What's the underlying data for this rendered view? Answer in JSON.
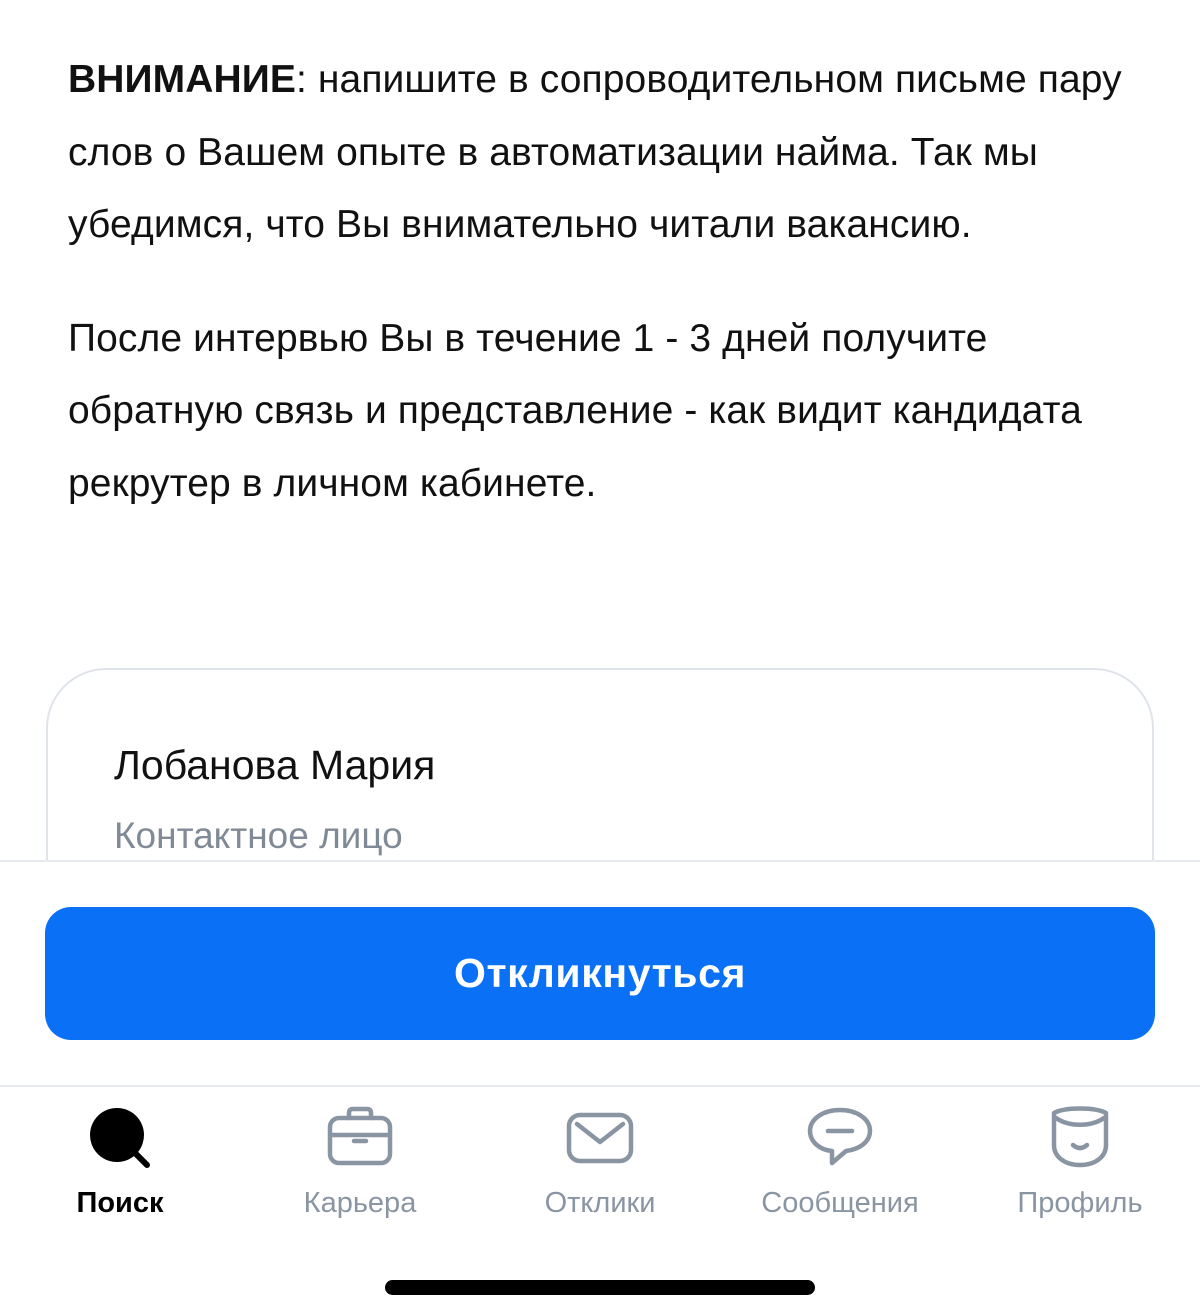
{
  "vacancy": {
    "attention_bold": "ВНИМАНИЕ",
    "attention_text": ": напишите в сопроводительном письме пару слов о Вашем опыте в автоматизации найма. Так мы убедимся, что Вы внимательно читали вакансию.",
    "feedback_text": "После интервью Вы в течение 1 - 3 дней получите обратную связь и представление - как видит кандидата рекрутер в личном кабинете."
  },
  "contact": {
    "name": "Лобанова Мария",
    "role": "Контактное лицо"
  },
  "action": {
    "respond_label": "Откликнуться",
    "color": "#0a70f5"
  },
  "tabbar": {
    "items": [
      {
        "label": "Поиск",
        "icon": "search-icon",
        "active": true
      },
      {
        "label": "Карьера",
        "icon": "briefcase-icon",
        "active": false
      },
      {
        "label": "Отклики",
        "icon": "envelope-icon",
        "active": false
      },
      {
        "label": "Сообщения",
        "icon": "chat-bubble-icon",
        "active": false
      },
      {
        "label": "Профиль",
        "icon": "profile-face-icon",
        "active": false
      }
    ],
    "active_color": "#000000",
    "inactive_color": "#8a95a3"
  }
}
